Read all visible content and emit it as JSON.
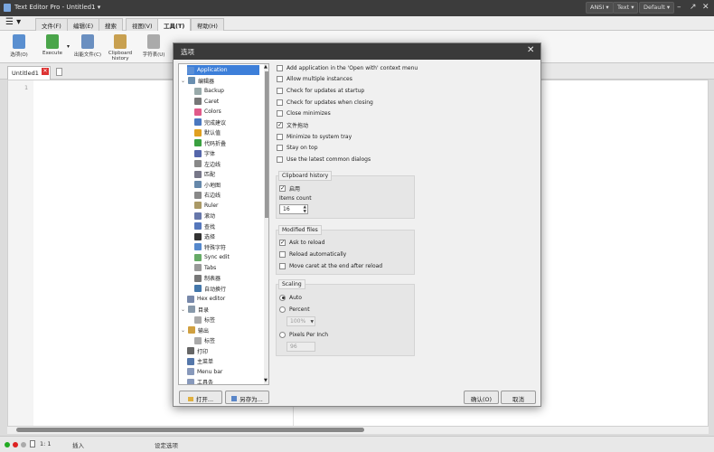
{
  "app": {
    "title": "Text Editor Pro  -  Untitled1 ▾",
    "encoding": "ANSI ▾",
    "syntax": "Text ▾",
    "theme": "Default ▾"
  },
  "menu": {
    "tabs": [
      "文件(F)",
      "编辑(E)",
      "搜索",
      "视图(V)",
      "工具(T)",
      "帮助(H)"
    ],
    "active_index": 4
  },
  "ribbon": {
    "buttons": [
      "选项(O)",
      "Execute",
      "出能文件(C)",
      "Clipboard history",
      "字符表(U)"
    ]
  },
  "document": {
    "tab_label": "Untitled1",
    "line_number": "1"
  },
  "status": {
    "position": "1: 1",
    "mode": "插入",
    "message": "设定选项"
  },
  "dialog": {
    "title": "选项",
    "tree": [
      {
        "label": "Application",
        "level": 0,
        "selected": true,
        "icon_color": "#5b8fd6"
      },
      {
        "label": "编辑器",
        "level": 0,
        "expander": "⌄",
        "icon_color": "#6a8fb0"
      },
      {
        "label": "Backup",
        "level": 1,
        "icon_color": "#9aa"
      },
      {
        "label": "Caret",
        "level": 1,
        "icon_color": "#777"
      },
      {
        "label": "Colors",
        "level": 1,
        "icon_color": "#e05a8a"
      },
      {
        "label": "完成建议",
        "level": 1,
        "icon_color": "#4a78c0"
      },
      {
        "label": "默认值",
        "level": 1,
        "icon_color": "#e0a020"
      },
      {
        "label": "代码折叠",
        "level": 1,
        "icon_color": "#3aa040"
      },
      {
        "label": "字体",
        "level": 1,
        "icon_color": "#5566aa"
      },
      {
        "label": "左边线",
        "level": 1,
        "icon_color": "#888"
      },
      {
        "label": "匹配",
        "level": 1,
        "icon_color": "#778"
      },
      {
        "label": "小地图",
        "level": 1,
        "icon_color": "#6688aa"
      },
      {
        "label": "右边线",
        "level": 1,
        "icon_color": "#888"
      },
      {
        "label": "Ruler",
        "level": 1,
        "icon_color": "#aa9966"
      },
      {
        "label": "滚动",
        "level": 1,
        "icon_color": "#6677aa"
      },
      {
        "label": "查找",
        "level": 1,
        "icon_color": "#5577bb"
      },
      {
        "label": "选择",
        "level": 1,
        "icon_color": "#333"
      },
      {
        "label": "特殊字符",
        "level": 1,
        "icon_color": "#5588cc"
      },
      {
        "label": "Sync edit",
        "level": 1,
        "icon_color": "#66aa66"
      },
      {
        "label": "Tabs",
        "level": 1,
        "icon_color": "#999"
      },
      {
        "label": "制表器",
        "level": 1,
        "icon_color": "#777"
      },
      {
        "label": "自动换行",
        "level": 1,
        "icon_color": "#4477aa"
      },
      {
        "label": "Hex editor",
        "level": 0,
        "icon_color": "#7788aa"
      },
      {
        "label": "目录",
        "level": 0,
        "expander": "⌄",
        "icon_color": "#8899aa"
      },
      {
        "label": "标签",
        "level": 1,
        "icon_color": "#aaa"
      },
      {
        "label": "输出",
        "level": 0,
        "expander": "⌄",
        "icon_color": "#d0a040"
      },
      {
        "label": "标签",
        "level": 1,
        "icon_color": "#aaa"
      },
      {
        "label": "打印",
        "level": 0,
        "icon_color": "#666"
      },
      {
        "label": "主菜单",
        "level": 0,
        "icon_color": "#5577aa"
      },
      {
        "label": "Menu bar",
        "level": 0,
        "icon_color": "#8899bb"
      },
      {
        "label": "工具条",
        "level": 0,
        "icon_color": "#8899bb"
      }
    ],
    "general_options": [
      {
        "label": "Add application in the 'Open with' context menu",
        "checked": false
      },
      {
        "label": "Allow multiple instances",
        "checked": false
      },
      {
        "label": "Check for updates at startup",
        "checked": false
      },
      {
        "label": "Check for updates when closing",
        "checked": false
      },
      {
        "label": "Close minimizes",
        "checked": false
      },
      {
        "label": "文件拖动",
        "checked": true
      },
      {
        "label": "Minimize to system tray",
        "checked": false
      },
      {
        "label": "Stay on top",
        "checked": false
      },
      {
        "label": "Use the latest common dialogs",
        "checked": false
      }
    ],
    "clipboard": {
      "title": "Clipboard history",
      "enabled_label": "启用",
      "enabled": true,
      "items_label": "Items count",
      "items_value": "16"
    },
    "modified": {
      "title": "Modified files",
      "options": [
        {
          "label": "Ask to reload",
          "checked": true
        },
        {
          "label": "Reload automatically",
          "checked": false
        },
        {
          "label": "Move caret at the end after reload",
          "checked": false
        }
      ]
    },
    "scaling": {
      "title": "Scaling",
      "auto": "Auto",
      "percent": "Percent",
      "percent_value": "100%",
      "ppi": "Pixels Per Inch",
      "ppi_value": "96",
      "selected": "auto"
    },
    "buttons": {
      "open": "打开...",
      "save_as": "另存为...",
      "ok": "确认(O)",
      "cancel": "取消"
    }
  }
}
